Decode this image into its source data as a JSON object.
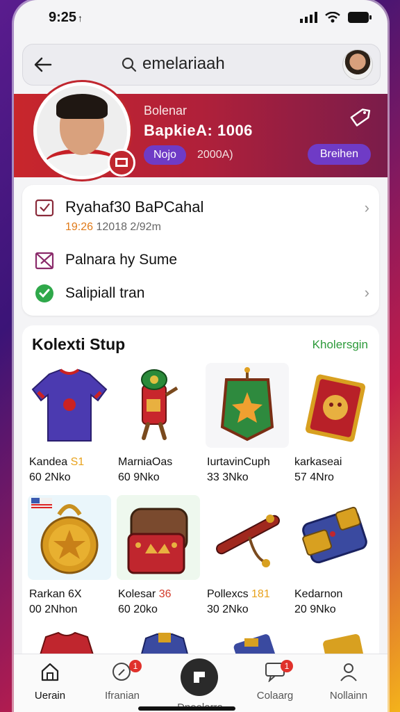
{
  "status": {
    "time": "9:25",
    "time_arrow": "↑"
  },
  "search": {
    "query": "emelariaah"
  },
  "profile": {
    "subtitle": "Bolenar",
    "name": "BapkieA: 1006",
    "pill_label": "Nojo",
    "stat": "2000A)",
    "action_label": "Breihen"
  },
  "info": {
    "row1_title": "Ryahaf30  BaPCahal",
    "row1_meta_highlight": "19:26",
    "row1_meta_rest": " 12018   2/92m",
    "row2_label": "Palnara hy Sume",
    "row3_label": "Salipiall tran"
  },
  "collection": {
    "heading": "Kolexti Stup",
    "link": "Kholersgin",
    "items": [
      {
        "name": "Kandea",
        "tag": "S1",
        "price": "60 2Nko",
        "icon": "jersey-icon"
      },
      {
        "name": "MarniaOas",
        "tag": "",
        "price": "60 9Nko",
        "icon": "tube-figure-icon"
      },
      {
        "name": "IurtavinCuph",
        "tag": "",
        "price": "33 3Nko",
        "icon": "banner-icon"
      },
      {
        "name": "karkaseai",
        "tag": "",
        "price": "57 4Nro",
        "icon": "card-icon"
      },
      {
        "name": "Rarkan 6X",
        "tag": "",
        "price": "00 2Nhon",
        "icon": "medal-icon"
      },
      {
        "name": "Kolesar",
        "tag": "36",
        "price": "60 20ko",
        "icon": "backpack-icon"
      },
      {
        "name": "Pollexcs",
        "tag": "181",
        "price": "30 2Nko",
        "icon": "rod-icon"
      },
      {
        "name": "Kedarnon",
        "tag": "",
        "price": "20 9Nko",
        "icon": "armband-icon"
      }
    ]
  },
  "nav": {
    "items": [
      {
        "label": "Uerain",
        "icon": "home-icon",
        "badge": ""
      },
      {
        "label": "Ifranian",
        "icon": "search-icon",
        "badge": "1"
      },
      {
        "label": "Dnoelarra",
        "icon": "scan-icon",
        "badge": ""
      },
      {
        "label": "Colaarg",
        "icon": "chat-icon",
        "badge": "1"
      },
      {
        "label": "Nollainn",
        "icon": "user-icon",
        "badge": ""
      }
    ]
  },
  "colors": {
    "accent_red": "#c8262c",
    "accent_purple": "#6f3bc6",
    "link_green": "#2c9a3a"
  }
}
